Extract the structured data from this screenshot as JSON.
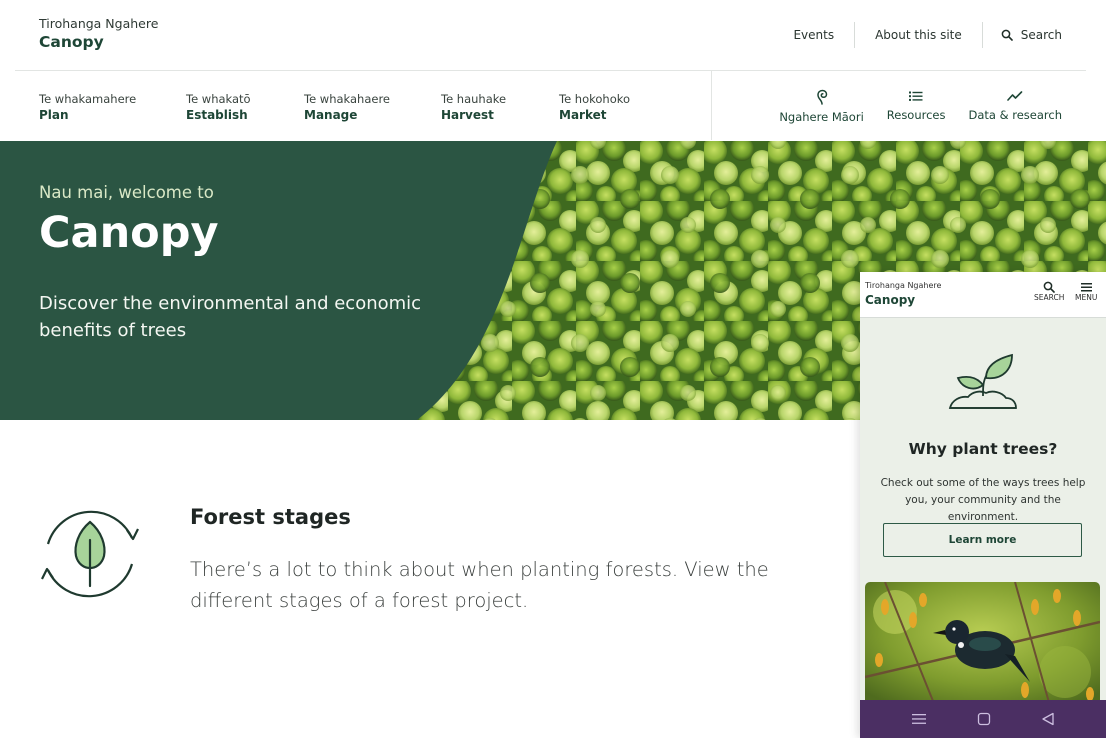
{
  "header": {
    "brand_subtitle": "Tirohanga Ngahere",
    "brand_title": "Canopy",
    "utility_links": [
      "Events",
      "About this site"
    ],
    "search_label": "Search"
  },
  "main_nav": [
    {
      "sub": "Te whakamahere",
      "main": "Plan"
    },
    {
      "sub": "Te whakatō",
      "main": "Establish"
    },
    {
      "sub": "Te whakahaere",
      "main": "Manage"
    },
    {
      "sub": "Te hauhake",
      "main": "Harvest"
    },
    {
      "sub": "Te hokohoko",
      "main": "Market"
    }
  ],
  "icon_nav": [
    {
      "label": "Ngahere Māori",
      "icon": "koru-icon"
    },
    {
      "label": "Resources",
      "icon": "list-icon"
    },
    {
      "label": "Data & research",
      "icon": "trend-line-icon"
    }
  ],
  "hero": {
    "kicker": "Nau mai, welcome to",
    "title": "Canopy",
    "description": "Discover the environmental and economic benefits of trees"
  },
  "forest_stages": {
    "title": "Forest stages",
    "description": "There’s a lot to think about when planting forests. View the different stages of a forest project."
  },
  "mobile": {
    "brand_subtitle": "Tirohanga Ngahere",
    "brand_title": "Canopy",
    "search_label": "SEARCH",
    "menu_label": "MENU",
    "card_title": "Why plant trees?",
    "card_description": "Check out some of the ways trees help you, your community and the environment.",
    "button_label": "Learn more"
  },
  "colors": {
    "brand_green": "#2b5543",
    "accent_light_green": "#d9e8c6",
    "android_nav": "#4b2f63"
  }
}
